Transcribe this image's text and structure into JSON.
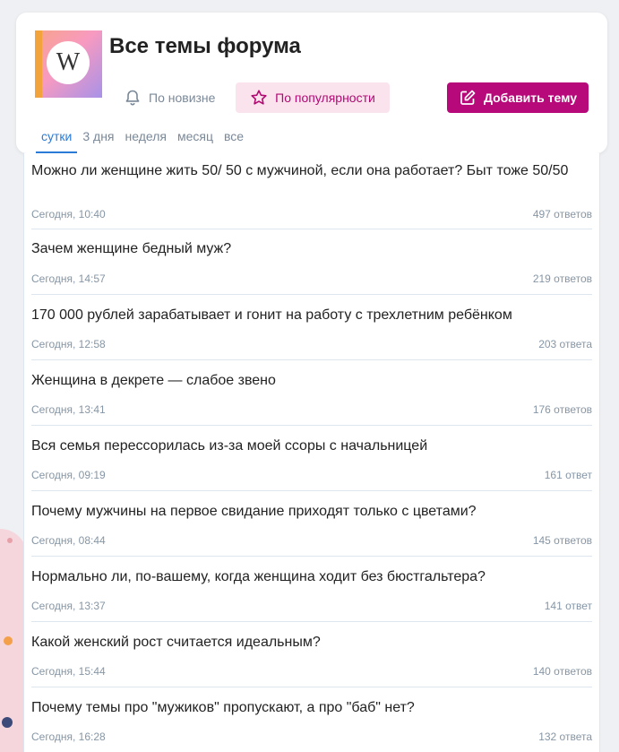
{
  "header": {
    "logo_letter": "W",
    "title": "Все темы форума",
    "sort_newest_label": "По новизне",
    "sort_popular_label": "По популярности",
    "add_topic_label": "Добавить тему",
    "accent_color": "#b8097a",
    "active_tab_color": "#2a7bd8"
  },
  "tabs": [
    {
      "label": "сутки",
      "active": true
    },
    {
      "label": "3 дня",
      "active": false
    },
    {
      "label": "неделя",
      "active": false
    },
    {
      "label": "месяц",
      "active": false
    },
    {
      "label": "все",
      "active": false
    }
  ],
  "topics": [
    {
      "title": "Можно ли женщине жить 50/ 50 с мужчиной, если она работает? Быт тоже 50/50",
      "time": "Сегодня, 10:40",
      "replies": "497 ответов"
    },
    {
      "title": "Зачем женщине бедный муж?",
      "time": "Сегодня, 14:57",
      "replies": "219 ответов"
    },
    {
      "title": "170 000 рублей зарабатывает и гонит на работу с трехлетним ребёнком",
      "time": "Сегодня, 12:58",
      "replies": "203 ответа"
    },
    {
      "title": "Женщина в декрете — слабое звено",
      "time": "Сегодня, 13:41",
      "replies": "176 ответов"
    },
    {
      "title": "Вся семья перессорилась из-за моей ссоры с начальницей",
      "time": "Сегодня, 09:19",
      "replies": "161 ответ"
    },
    {
      "title": "Почему мужчины на первое свидание приходят только с цветами?",
      "time": "Сегодня, 08:44",
      "replies": "145 ответов"
    },
    {
      "title": "Нормально ли, по-вашему, когда женщина ходит без бюстгальтера?",
      "time": "Сегодня, 13:37",
      "replies": "141 ответ"
    },
    {
      "title": "Какой женский рост считается идеальным?",
      "time": "Сегодня, 15:44",
      "replies": "140 ответов"
    },
    {
      "title": "Почему темы про \"мужиков\" пропускают, а про \"баб\" нет?",
      "time": "Сегодня, 16:28",
      "replies": "132 ответа"
    }
  ]
}
